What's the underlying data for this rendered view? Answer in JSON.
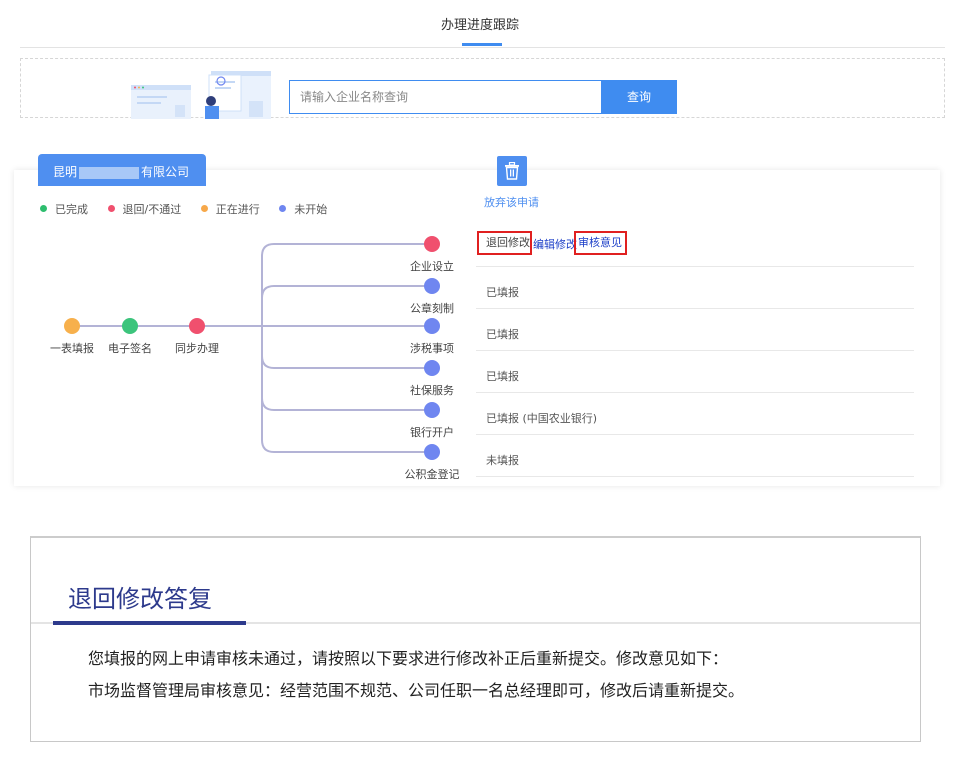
{
  "header": {
    "title": "办理进度跟踪"
  },
  "search": {
    "placeholder": "请输入企业名称查询",
    "button_label": "查询"
  },
  "company_tab": {
    "prefix": "昆明",
    "suffix": "有限公司"
  },
  "legend": [
    {
      "label": "已完成",
      "color": "#2dbd6e"
    },
    {
      "label": "退回/不通过",
      "color": "#f0506e"
    },
    {
      "label": "正在进行",
      "color": "#f7a84a"
    },
    {
      "label": "未开始",
      "color": "#6f86f0"
    }
  ],
  "abandon": {
    "icon": "trash-icon",
    "label": "放弃该申请"
  },
  "main_steps": [
    {
      "label": "一表填报",
      "status": "in-progress",
      "color": "#f7b04c"
    },
    {
      "label": "电子签名",
      "status": "done",
      "color": "#3cc47c"
    },
    {
      "label": "同步办理",
      "status": "returned",
      "color": "#f0506e"
    }
  ],
  "branches": [
    {
      "label": "企业设立",
      "color": "#f0506e",
      "status": "退回修改"
    },
    {
      "label": "公章刻制",
      "color": "#6f86f0",
      "status": "已填报"
    },
    {
      "label": "涉税事项",
      "color": "#6f86f0",
      "status": "已填报"
    },
    {
      "label": "社保服务",
      "color": "#6f86f0",
      "status": "已填报"
    },
    {
      "label": "银行开户",
      "color": "#6f86f0",
      "status": "已填报 (中国农业银行)"
    },
    {
      "label": "公积金登记",
      "color": "#6f86f0",
      "status": "未填报"
    }
  ],
  "actions": {
    "return_label": "退回修改",
    "edit_label": "编辑修改",
    "opinion_label": "审核意见"
  },
  "reply": {
    "title": "退回修改答复",
    "line1": "您填报的网上申请审核未通过，请按照以下要求进行修改补正后重新提交。修改意见如下：",
    "line2": "市场监督管理局审核意见：经营范围不规范、公司任职一名总经理即可，修改后请重新提交。"
  }
}
